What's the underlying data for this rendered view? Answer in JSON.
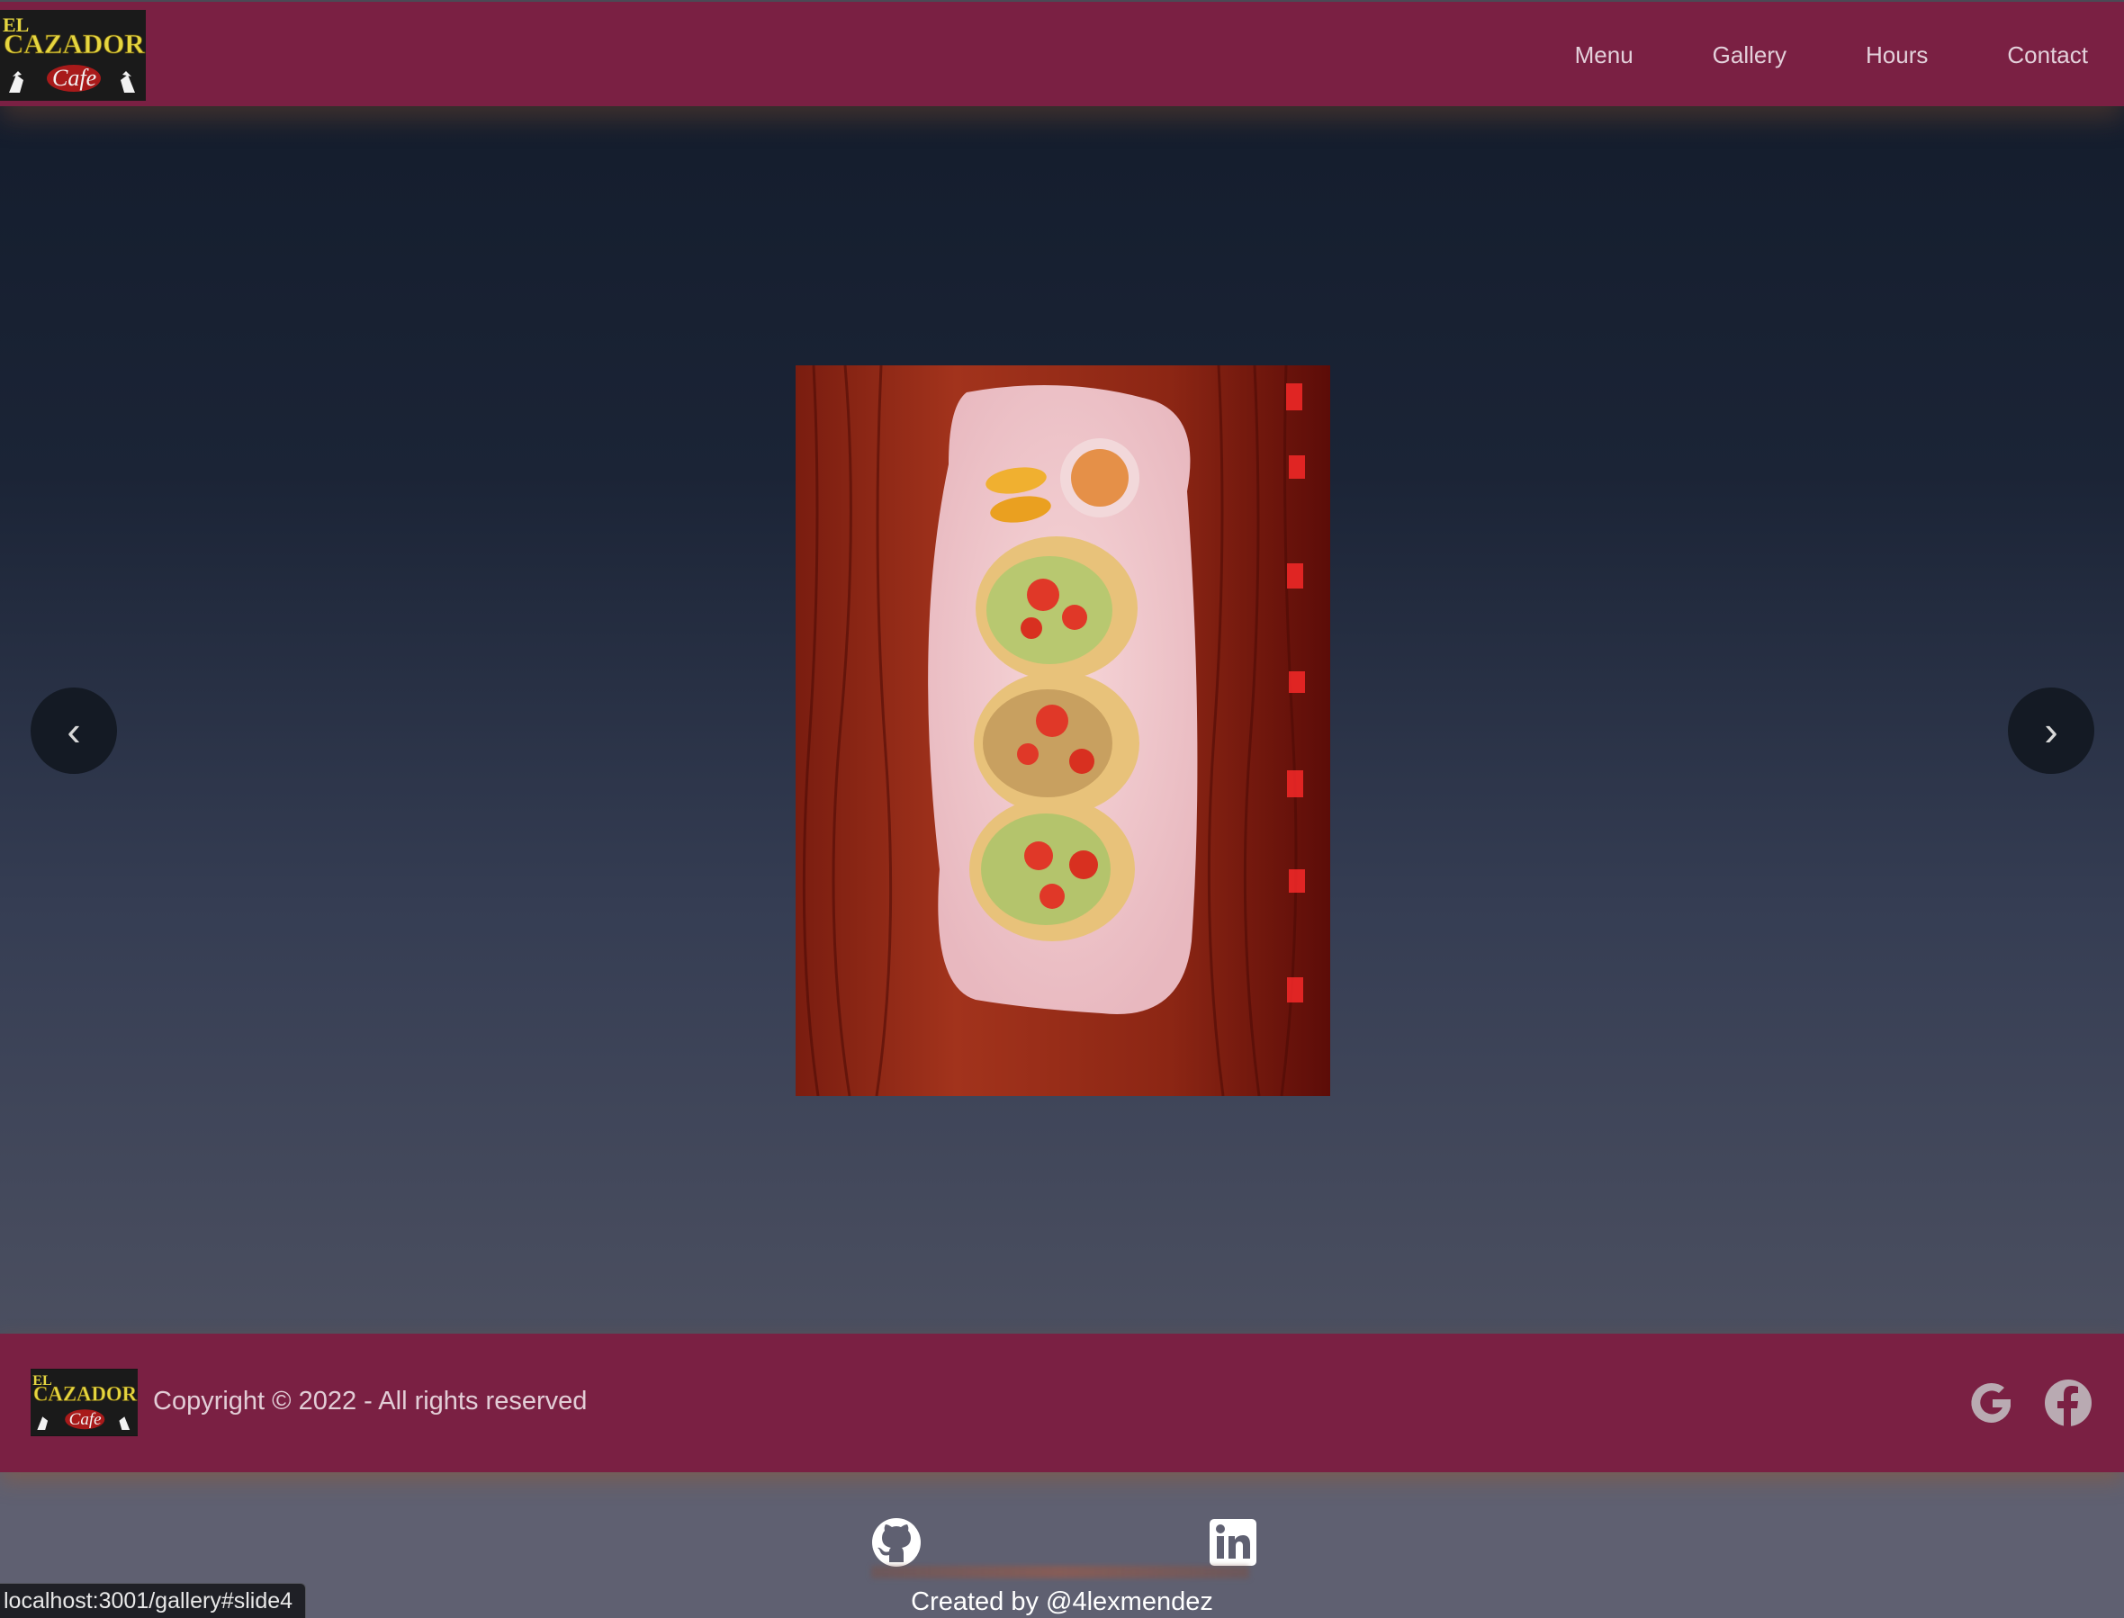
{
  "brand": {
    "logo_line1": "EL",
    "logo_line2": "CAZADOR",
    "logo_line3": "Cafe"
  },
  "nav": {
    "items": [
      {
        "label": "Menu"
      },
      {
        "label": "Gallery"
      },
      {
        "label": "Hours"
      },
      {
        "label": "Contact"
      }
    ]
  },
  "carousel": {
    "prev_label": "‹",
    "next_label": "›",
    "image_icon": "tacos-plate-photo"
  },
  "footer": {
    "copyright": "Copyright © 2022 - All rights reserved",
    "social_icons": [
      "google-icon",
      "facebook-icon"
    ]
  },
  "bottom": {
    "icons": [
      "github-icon",
      "linkedin-icon"
    ],
    "credit": "Created by @4lexmendez"
  },
  "status_bar": {
    "url": "localhost:3001/gallery#slide4"
  },
  "colors": {
    "header_bg": "#7a2043",
    "footer_bg": "#7a2043",
    "main_top": "#141d2d",
    "main_bottom": "#4b4f60",
    "bottom_bg": "#5f6071"
  }
}
